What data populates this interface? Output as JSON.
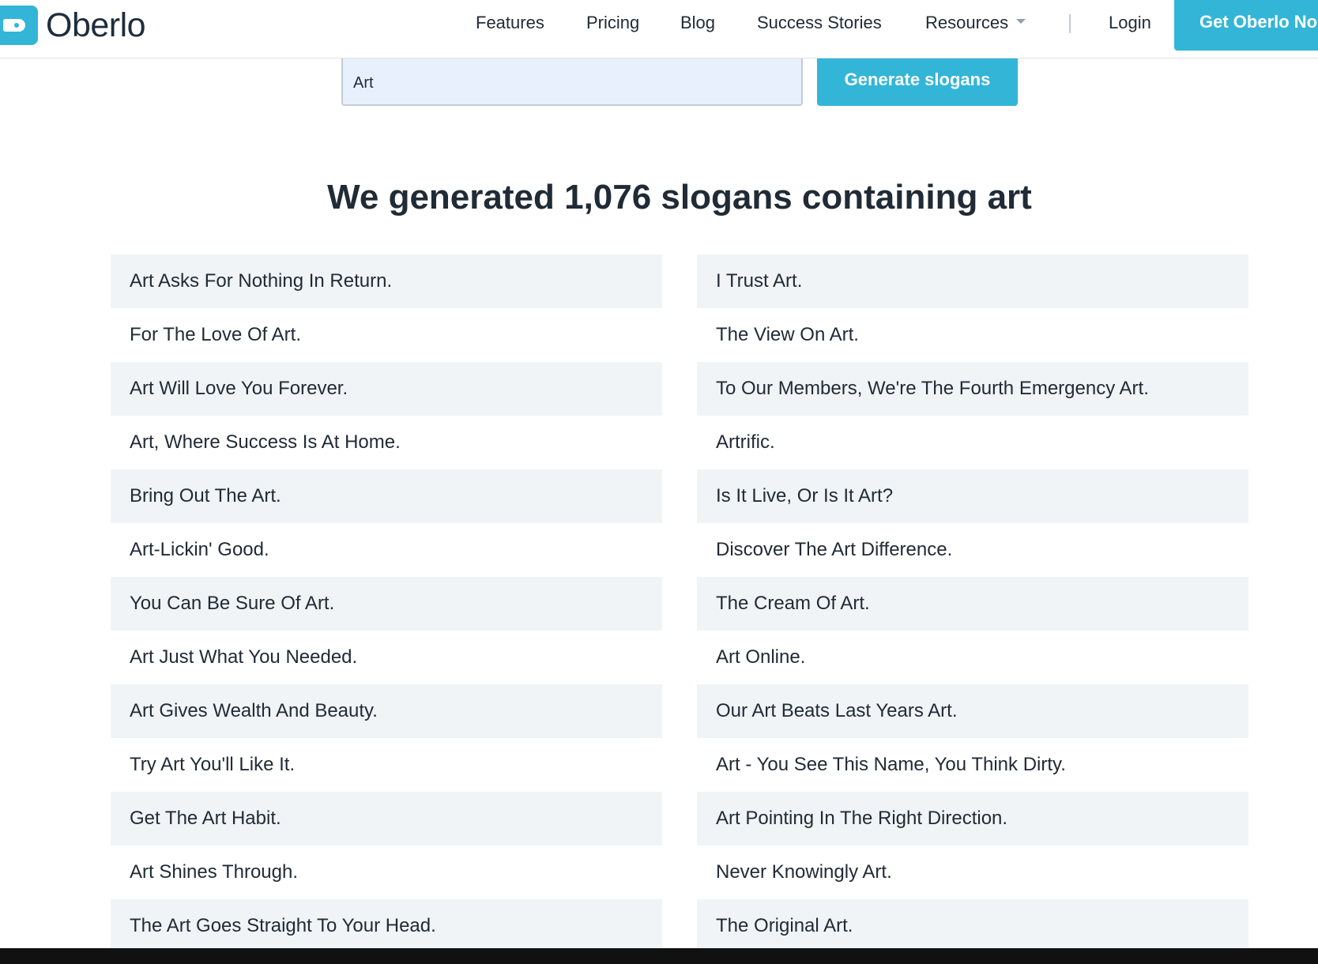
{
  "brand": {
    "name": "Oberlo",
    "accent": "#33b5d8",
    "text_color": "#212b36"
  },
  "nav": {
    "features": "Features",
    "pricing": "Pricing",
    "blog": "Blog",
    "success_stories": "Success Stories",
    "resources": "Resources",
    "login": "Login",
    "cta": "Get Oberlo No"
  },
  "search": {
    "value": "Art",
    "button": "Generate slogans"
  },
  "results": {
    "heading": "We generated 1,076 slogans containing art",
    "slogans": [
      "Art Asks For Nothing In Return.",
      "I Trust Art.",
      "For The Love Of Art.",
      "The View On Art.",
      "Art Will Love You Forever.",
      "To Our Members, We're The Fourth Emergency Art.",
      "Art, Where Success Is At Home.",
      "Artrific.",
      "Bring Out The Art.",
      "Is It Live, Or Is It Art?",
      "Art-Lickin' Good.",
      "Discover The Art Difference.",
      "You Can Be Sure Of Art.",
      "The Cream Of Art.",
      "Art Just What You Needed.",
      "Art Online.",
      "Art Gives Wealth And Beauty.",
      "Our Art Beats Last Years Art.",
      "Try Art You'll Like It.",
      "Art - You See This Name, You Think Dirty.",
      "Get The Art Habit.",
      "Art Pointing In The Right Direction.",
      "Art Shines Through.",
      "Never Knowingly Art.",
      "The Art Goes Straight To Your Head.",
      "The Original Art."
    ]
  }
}
